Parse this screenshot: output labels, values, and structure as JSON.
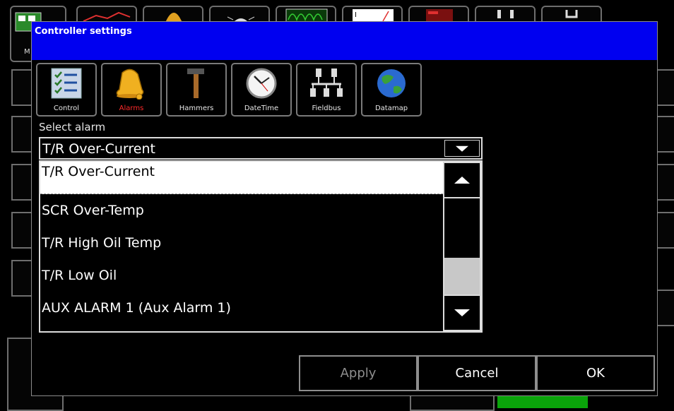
{
  "dialog": {
    "title": "Controller settings"
  },
  "tabs": [
    {
      "label": "Control",
      "icon": "checklist-icon",
      "active": false
    },
    {
      "label": "Alarms",
      "icon": "bell-icon",
      "active": true
    },
    {
      "label": "Hammers",
      "icon": "hammer-icon",
      "active": false
    },
    {
      "label": "DateTime",
      "icon": "clock-icon",
      "active": false
    },
    {
      "label": "Fieldbus",
      "icon": "network-icon",
      "active": false
    },
    {
      "label": "Datamap",
      "icon": "globe-icon",
      "active": false
    }
  ],
  "alarm_select": {
    "label": "Select alarm",
    "value": "T/R Over-Current",
    "options": [
      "T/R Over-Current",
      "SCR Over-Temp",
      "T/R High Oil Temp",
      "T/R Low Oil",
      "AUX ALARM 1 (Aux Alarm 1)"
    ]
  },
  "buttons": {
    "apply": "Apply",
    "cancel": "Cancel",
    "ok": "OK"
  },
  "background": {
    "partial_letter": "M"
  },
  "colors": {
    "titlebar": "#0000f0",
    "active_tab_label": "#ff2a2a",
    "green_panel": "#0aa40a"
  }
}
